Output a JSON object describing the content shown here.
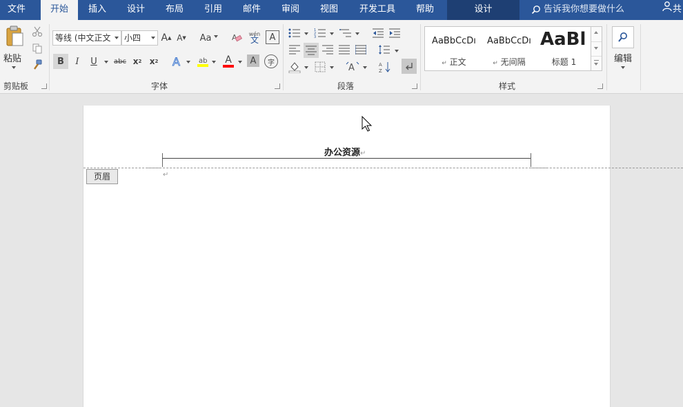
{
  "tabs": {
    "file": "文件",
    "home": "开始",
    "insert": "插入",
    "design": "设计",
    "layout": "布局",
    "references": "引用",
    "mailings": "邮件",
    "review": "审阅",
    "view": "视图",
    "developer": "开发工具",
    "help": "帮助",
    "header_design": "设计"
  },
  "tell_me": {
    "icon": "search-icon",
    "text": "告诉我你想要做什么"
  },
  "share": {
    "icon": "person-icon",
    "label": "共"
  },
  "ribbon": {
    "clipboard": {
      "paste_label": "粘贴",
      "group_label": "剪贴板"
    },
    "font": {
      "font_name": "等线 (中文正文",
      "font_size": "小四",
      "change_case": "Aa",
      "bold": "B",
      "italic": "I",
      "underline": "U",
      "strikethrough": "abc",
      "subscript": "x",
      "superscript": "x",
      "font_color": "A",
      "char_shading": "A",
      "enclose": "字",
      "phonetic_top": "wén",
      "phonetic_bottom": "文",
      "group_label": "字体",
      "highlight_color": "#ffff00",
      "font_color_value": "#ff0000"
    },
    "paragraph": {
      "group_label": "段落"
    },
    "styles": {
      "items": [
        {
          "sample": "AaBbCcDı",
          "name": "正文",
          "prefix": "↵"
        },
        {
          "sample": "AaBbCcDı",
          "name": "无间隔",
          "prefix": "↵"
        },
        {
          "sample": "AaBl",
          "name": "标题 1",
          "prefix": ""
        }
      ],
      "group_label": "样式"
    },
    "editing": {
      "label": "编辑"
    }
  },
  "document": {
    "header_text": "办公资源",
    "header_badge": "页眉",
    "paragraph_mark": "↵"
  },
  "colors": {
    "tab_bar": "#2b579a",
    "ribbon_bg": "#f3f3f3",
    "workspace": "#e6e6e6"
  }
}
